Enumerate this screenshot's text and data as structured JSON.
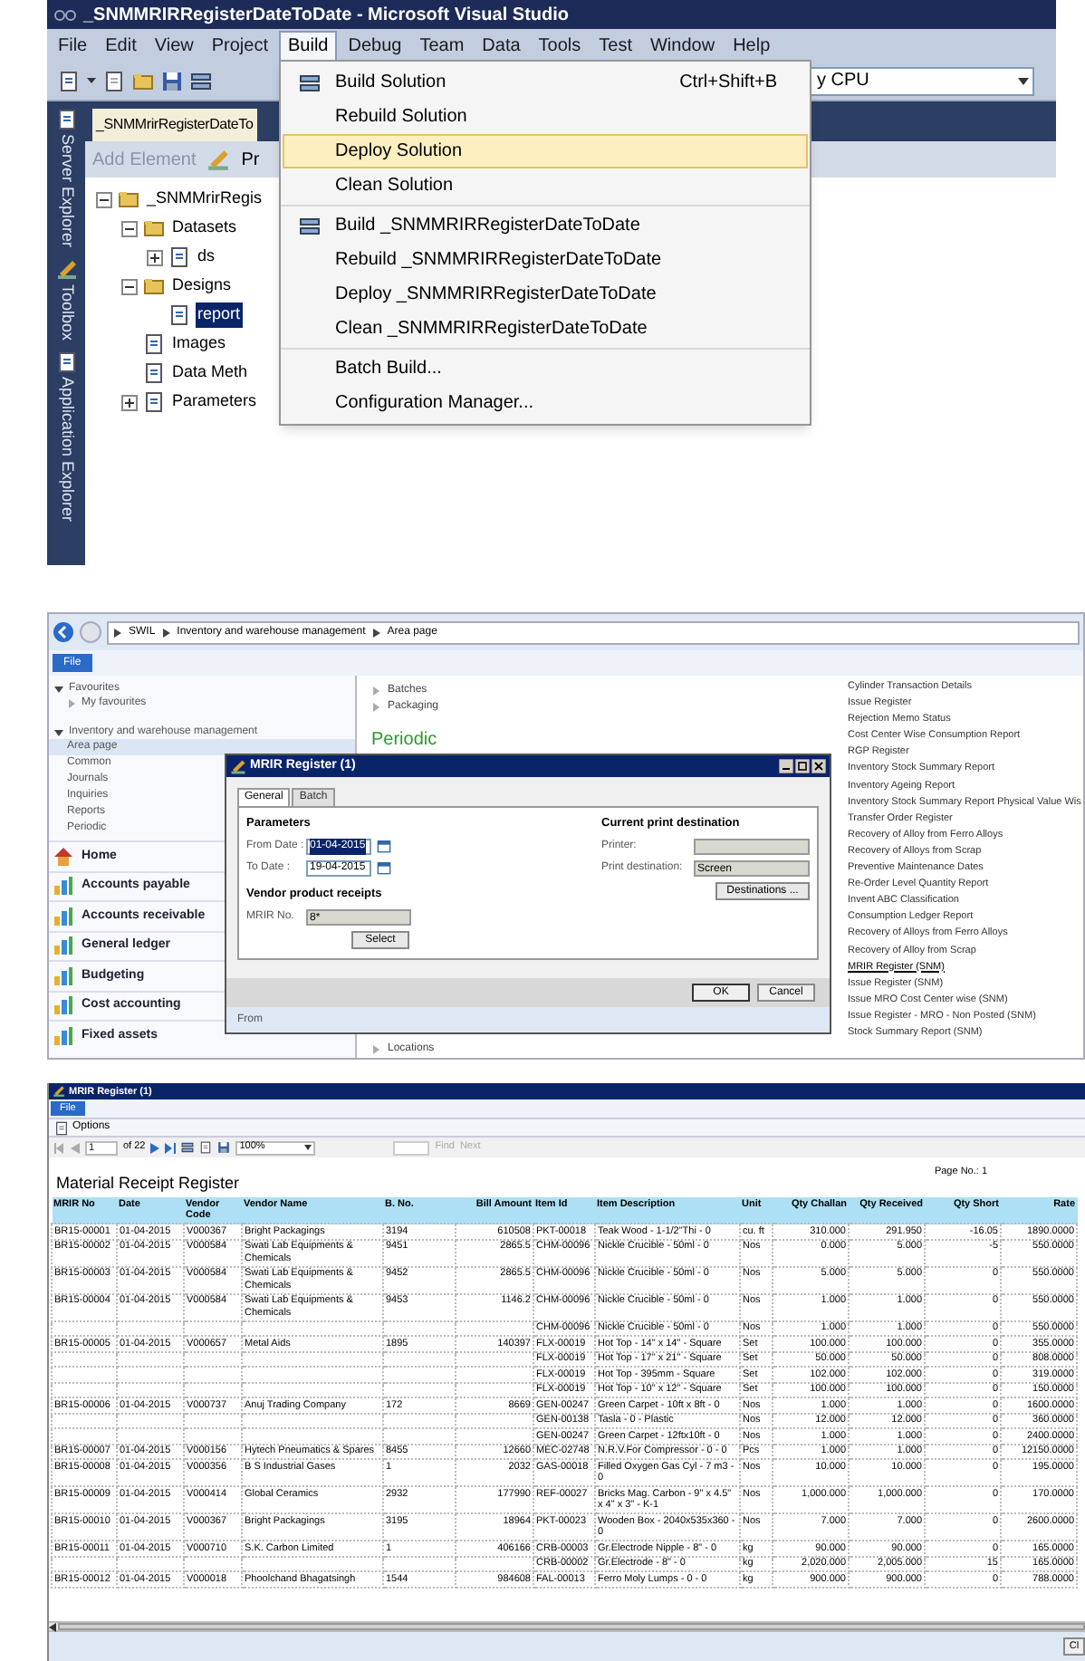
{
  "vs": {
    "title": "_SNMMRIRRegisterDateToDate - Microsoft Visual Studio",
    "menus": [
      {
        "label": "File",
        "selected": false
      },
      {
        "label": "Edit",
        "selected": false
      },
      {
        "label": "View",
        "selected": false
      },
      {
        "label": "Project",
        "selected": false
      },
      {
        "label": "Build",
        "selected": true
      },
      {
        "label": "Debug",
        "selected": false
      },
      {
        "label": "Team",
        "selected": false
      },
      {
        "label": "Data",
        "selected": false
      },
      {
        "label": "Tools",
        "selected": false
      },
      {
        "label": "Test",
        "selected": false
      },
      {
        "label": "Window",
        "selected": false
      },
      {
        "label": "Help",
        "selected": false
      }
    ],
    "config_combo": "y CPU",
    "side_tabs": [
      "Server Explorer",
      "Toolbox",
      "Application Explorer"
    ],
    "document_tab": "_SNMMrirRegisterDateTo",
    "element_toolbar": {
      "add_element": "Add Element",
      "button_2": "Pr"
    },
    "tree": [
      {
        "label": "_SNMMrirRegis",
        "expanded": true,
        "selected": false,
        "children": [
          {
            "label": "Datasets",
            "expanded": true,
            "selected": false,
            "children": [
              {
                "label": "ds",
                "expanded": false,
                "selected": false
              }
            ]
          },
          {
            "label": "Designs",
            "expanded": true,
            "selected": false,
            "children": [
              {
                "label": "report",
                "selected": true
              }
            ]
          },
          {
            "label": "Images",
            "selected": false
          },
          {
            "label": "Data Meth",
            "selected": false
          },
          {
            "label": "Parameters",
            "expanded": false,
            "selected": false
          }
        ]
      }
    ],
    "build_menu": [
      [
        {
          "label": "Build Solution",
          "shortcut": "Ctrl+Shift+B",
          "icon": true,
          "selected": false
        },
        {
          "label": "Rebuild Solution",
          "icon": false,
          "selected": false
        },
        {
          "label": "Deploy Solution",
          "icon": false,
          "selected": true
        },
        {
          "label": "Clean Solution",
          "icon": false,
          "selected": false
        }
      ],
      [
        {
          "label": "Build _SNMMRIRRegisterDateToDate",
          "icon": true,
          "selected": false
        },
        {
          "label": "Rebuild _SNMMRIRRegisterDateToDate",
          "icon": false,
          "selected": false
        },
        {
          "label": "Deploy _SNMMRIRRegisterDateToDate",
          "icon": false,
          "selected": false
        },
        {
          "label": "Clean _SNMMRIRRegisterDateToDate",
          "icon": false,
          "selected": false
        }
      ],
      [
        {
          "label": "Batch Build...",
          "icon": false,
          "selected": false
        },
        {
          "label": "Configuration Manager...",
          "icon": false,
          "selected": false
        }
      ]
    ]
  },
  "ax": {
    "breadcrumb": [
      "SWIL",
      "Inventory and warehouse management",
      "Area page"
    ],
    "file_button": "File",
    "favourites": {
      "label": "Favourites",
      "expanded": true,
      "items": [
        "My favourites"
      ]
    },
    "module": {
      "label": "Inventory and warehouse management",
      "expanded": true,
      "items": [
        {
          "label": "Area page",
          "selected": true
        },
        {
          "label": "Common",
          "selected": false
        },
        {
          "label": "Journals",
          "selected": false
        },
        {
          "label": "Inquiries",
          "selected": false
        },
        {
          "label": "Reports",
          "selected": false
        },
        {
          "label": "Periodic",
          "selected": false
        }
      ]
    },
    "modules": [
      {
        "label": "Home",
        "kind": "home"
      },
      {
        "label": "Accounts payable",
        "kind": "module"
      },
      {
        "label": "Accounts receivable",
        "kind": "module"
      },
      {
        "label": "General ledger",
        "kind": "module"
      },
      {
        "label": "Budgeting",
        "kind": "module"
      },
      {
        "label": "Cost accounting",
        "kind": "module"
      },
      {
        "label": "Fixed assets",
        "kind": "module"
      }
    ],
    "content_links_top": [
      "Batches",
      "Packaging"
    ],
    "section_heading": "Periodic",
    "content_links_bottom": [
      "Locations"
    ],
    "reports": [
      {
        "label": "Cylinder Transaction Details",
        "selected": false
      },
      {
        "label": "Issue Register",
        "selected": false
      },
      {
        "label": "Rejection Memo Status",
        "selected": false
      },
      {
        "label": "Cost Center Wise Consumption Report",
        "selected": false
      },
      {
        "label": "RGP Register",
        "selected": false
      },
      {
        "label": "Inventory Stock Summary Report",
        "selected": false
      },
      {
        "label": "Inventory Ageing Report",
        "selected": false
      },
      {
        "label": "Inventory Stock Summary Report Physical Value Wis",
        "selected": false
      },
      {
        "label": "Transfer Order Register",
        "selected": false
      },
      {
        "label": "Recovery of Alloy from Ferro Alloys",
        "selected": false
      },
      {
        "label": "Recovery of Alloys from Scrap",
        "selected": false
      },
      {
        "label": "Preventive Maintenance Dates",
        "selected": false
      },
      {
        "label": "Re-Order Level Quantity Report",
        "selected": false
      },
      {
        "label": "Invent ABC Classification",
        "selected": false
      },
      {
        "label": "Consumption Ledger Report",
        "selected": false
      },
      {
        "label": "Recovery of Alloys from Ferro Alloys",
        "selected": false
      },
      {
        "label": "Recovery of Alloy from Scrap",
        "selected": false
      },
      {
        "label": "MRIR Register (SNM)",
        "selected": true
      },
      {
        "label": "Issue Register (SNM)",
        "selected": false
      },
      {
        "label": "Issue MRO Cost Center wise (SNM)",
        "selected": false
      },
      {
        "label": "Issue Register - MRO - Non Posted (SNM)",
        "selected": false
      },
      {
        "label": "Stock Summary Report (SNM)",
        "selected": false
      }
    ],
    "dialog": {
      "title": "MRIR Register (1)",
      "tabs": [
        {
          "label": "General",
          "selected": true
        },
        {
          "label": "Batch",
          "selected": false
        }
      ],
      "parameters_heading": "Parameters",
      "from_date": {
        "label": "From Date :",
        "value": "01-04-2015"
      },
      "to_date": {
        "label": "To Date :",
        "value": "19-04-2015"
      },
      "receipts_heading": "Vendor product receipts",
      "mrir_no": {
        "label": "MRIR No.",
        "value": "8*"
      },
      "select_button": "Select",
      "destination_heading": "Current print destination",
      "printer": {
        "label": "Printer:"
      },
      "print_destination": {
        "label": "Print destination:",
        "value": "Screen"
      },
      "destinations_button": "Destinations ...",
      "ok_button": "OK",
      "cancel_button": "Cancel",
      "footer": "From"
    }
  },
  "viewer": {
    "title": "MRIR Register (1)",
    "file_button": "File",
    "options": "Options",
    "page": "1",
    "page_count": "of 22",
    "zoom": "100%",
    "find": "Find",
    "next": "Next",
    "report_title": "Material Receipt Register",
    "page_no": "Page No.: 1",
    "close_button": "Cl",
    "columns": [
      "MRIR No",
      "Date",
      "Vendor Code",
      "Vendor Name",
      "B. No.",
      "Bill Amount",
      "Item Id",
      "Item Description",
      "Unit",
      "Qty Challan",
      "Qty Received",
      "Qty Short",
      "Rate"
    ],
    "rows": [
      {
        "mrir": "BR15-00001",
        "date": "01-04-2015",
        "vcode": "V000367",
        "vname": "Bright Packagings",
        "bno": "3194",
        "amount": "610508",
        "item": "PKT-00018",
        "desc": "Teak Wood - 1-1/2\"Thi - 0",
        "unit": "cu. ft",
        "qc": "310.000",
        "qr": "291.950",
        "qs": "-16.05",
        "rate": "1890.0000"
      },
      {
        "mrir": "BR15-00002",
        "date": "01-04-2015",
        "vcode": "V000584",
        "vname": "Swati Lab Equipments & Chemicals",
        "bno": "9451",
        "amount": "2865.5",
        "item": "CHM-00096",
        "desc": "Nickle Crucible - 50ml - 0",
        "unit": "Nos",
        "qc": "0.000",
        "qr": "5.000",
        "qs": "-5",
        "rate": "550.0000"
      },
      {
        "mrir": "BR15-00003",
        "date": "01-04-2015",
        "vcode": "V000584",
        "vname": "Swati Lab Equipments & Chemicals",
        "bno": "9452",
        "amount": "2865.5",
        "item": "CHM-00096",
        "desc": "Nickle Crucible - 50ml - 0",
        "unit": "Nos",
        "qc": "5.000",
        "qr": "5.000",
        "qs": "0",
        "rate": "550.0000"
      },
      {
        "mrir": "BR15-00004",
        "date": "01-04-2015",
        "vcode": "V000584",
        "vname": "Swati Lab Equipments & Chemicals",
        "bno": "9453",
        "amount": "1146.2",
        "item": "CHM-00096",
        "desc": "Nickle Crucible - 50ml - 0",
        "unit": "Nos",
        "qc": "1.000",
        "qr": "1.000",
        "qs": "0",
        "rate": "550.0000"
      },
      {
        "item": "CHM-00096",
        "desc": "Nickle Crucible - 50ml - 0",
        "unit": "Nos",
        "qc": "1.000",
        "qr": "1.000",
        "qs": "0",
        "rate": "550.0000"
      },
      {
        "mrir": "BR15-00005",
        "date": "01-04-2015",
        "vcode": "V000657",
        "vname": "Metal Aids",
        "bno": "1895",
        "amount": "140397",
        "item": "FLX-00019",
        "desc": "Hot Top - 14\" x 14\" - Square",
        "unit": "Set",
        "qc": "100.000",
        "qr": "100.000",
        "qs": "0",
        "rate": "355.0000"
      },
      {
        "item": "FLX-00019",
        "desc": "Hot Top - 17\" x 21\" - Square",
        "unit": "Set",
        "qc": "50.000",
        "qr": "50.000",
        "qs": "0",
        "rate": "808.0000"
      },
      {
        "item": "FLX-00019",
        "desc": "Hot Top - 395mm - Square",
        "unit": "Set",
        "qc": "102.000",
        "qr": "102.000",
        "qs": "0",
        "rate": "319.0000"
      },
      {
        "item": "FLX-00019",
        "desc": "Hot Top - 10\" x 12\" - Square",
        "unit": "Set",
        "qc": "100.000",
        "qr": "100.000",
        "qs": "0",
        "rate": "150.0000"
      },
      {
        "mrir": "BR15-00006",
        "date": "01-04-2015",
        "vcode": "V000737",
        "vname": "Anuj Trading Company",
        "bno": "172",
        "amount": "8669",
        "item": "GEN-00247",
        "desc": "Green Carpet - 10ft x 8ft - 0",
        "unit": "Nos",
        "qc": "1.000",
        "qr": "1.000",
        "qs": "0",
        "rate": "1600.0000"
      },
      {
        "item": "GEN-00138",
        "desc": "Tasla - 0 - Plastic",
        "unit": "Nos",
        "qc": "12.000",
        "qr": "12.000",
        "qs": "0",
        "rate": "360.0000"
      },
      {
        "item": "GEN-00247",
        "desc": "Green Carpet - 12ftx10ft - 0",
        "unit": "Nos",
        "qc": "1.000",
        "qr": "1.000",
        "qs": "0",
        "rate": "2400.0000"
      },
      {
        "mrir": "BR15-00007",
        "date": "01-04-2015",
        "vcode": "V000156",
        "vname": "Hytech Pneumatics & Spares",
        "bno": "8455",
        "amount": "12660",
        "item": "MEC-02748",
        "desc": "N.R.V.For Compressor - 0 - 0",
        "unit": "Pcs",
        "qc": "1.000",
        "qr": "1.000",
        "qs": "0",
        "rate": "12150.0000"
      },
      {
        "mrir": "BR15-00008",
        "date": "01-04-2015",
        "vcode": "V000356",
        "vname": "B S Industrial Gases",
        "bno": "1",
        "amount": "2032",
        "item": "GAS-00018",
        "desc": "Filled Oxygen Gas Cyl - 7 m3 - 0",
        "unit": "Nos",
        "qc": "10.000",
        "qr": "10.000",
        "qs": "0",
        "rate": "195.0000"
      },
      {
        "mrir": "BR15-00009",
        "date": "01-04-2015",
        "vcode": "V000414",
        "vname": "Global Ceramics",
        "bno": "2932",
        "amount": "177990",
        "item": "REF-00027",
        "desc": "Bricks Mag. Carbon - 9\" x 4.5\" x 4\" x 3\" - K-1",
        "unit": "Nos",
        "qc": "1,000.000",
        "qr": "1,000.000",
        "qs": "0",
        "rate": "170.0000"
      },
      {
        "mrir": "BR15-00010",
        "date": "01-04-2015",
        "vcode": "V000367",
        "vname": "Bright Packagings",
        "bno": "3195",
        "amount": "18964",
        "item": "PKT-00023",
        "desc": "Wooden Box - 2040x535x360 - 0",
        "unit": "Nos",
        "qc": "7.000",
        "qr": "7.000",
        "qs": "0",
        "rate": "2600.0000"
      },
      {
        "mrir": "BR15-00011",
        "date": "01-04-2015",
        "vcode": "V000710",
        "vname": "S.K. Carbon Limited",
        "bno": "1",
        "amount": "406166",
        "item": "CRB-00003",
        "desc": "Gr.Electrode Nipple - 8\" - 0",
        "unit": "kg",
        "qc": "90.000",
        "qr": "90.000",
        "qs": "0",
        "rate": "165.0000"
      },
      {
        "item": "CRB-00002",
        "desc": "Gr.Electrode - 8\" - 0",
        "unit": "kg",
        "qc": "2,020.000",
        "qr": "2,005.000",
        "qs": "15",
        "rate": "165.0000"
      },
      {
        "mrir": "BR15-00012",
        "date": "01-04-2015",
        "vcode": "V000018",
        "vname": "Phoolchand Bhagatsingh",
        "bno": "1544",
        "amount": "984608",
        "item": "FAL-00013",
        "desc": "Ferro Moly Lumps - 0 - 0",
        "unit": "kg",
        "qc": "900.000",
        "qr": "900.000",
        "qs": "0",
        "rate": "788.0000"
      }
    ]
  }
}
